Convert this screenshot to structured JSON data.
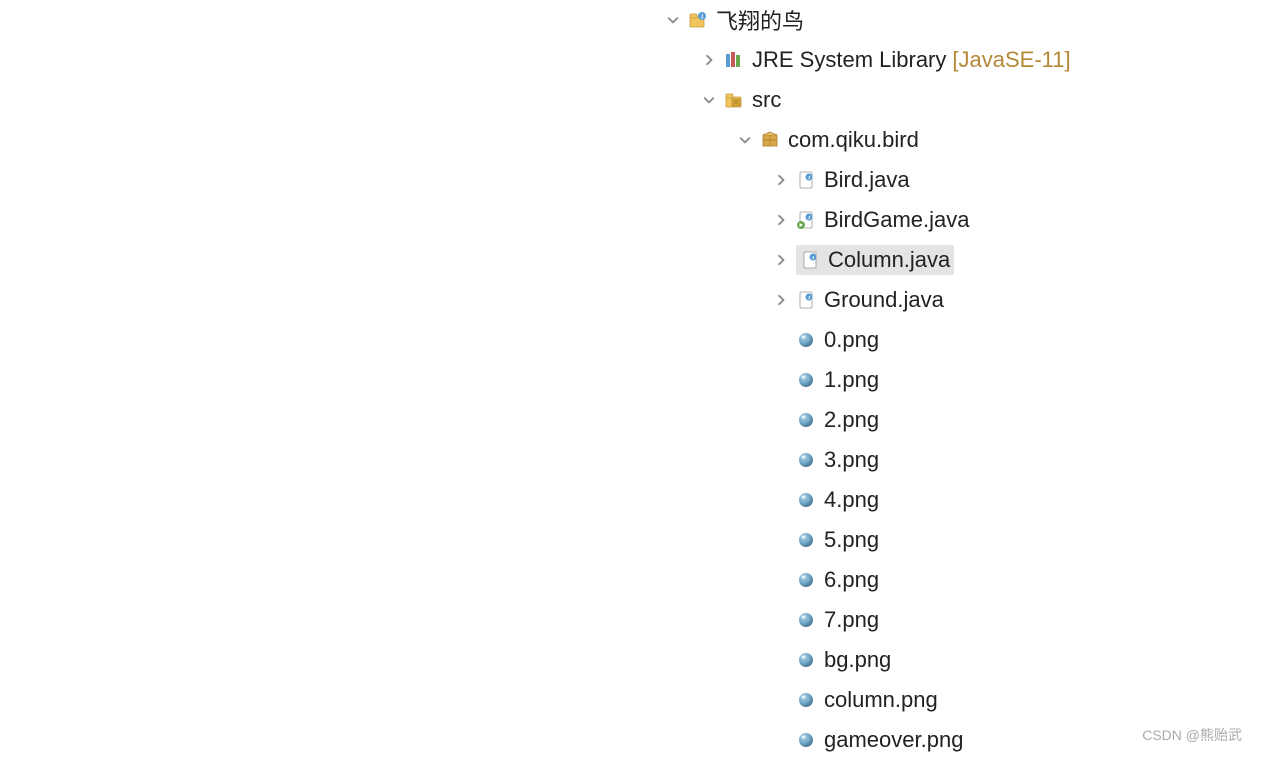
{
  "project": {
    "name": "飞翔的鸟"
  },
  "jre": {
    "label": "JRE System Library",
    "version": "[JavaSE-11]"
  },
  "src": {
    "label": "src"
  },
  "package": {
    "label": "com.qiku.bird"
  },
  "files": {
    "java": [
      "Bird.java",
      "BirdGame.java",
      "Column.java",
      "Ground.java"
    ],
    "png": [
      "0.png",
      "1.png",
      "2.png",
      "3.png",
      "4.png",
      "5.png",
      "6.png",
      "7.png",
      "bg.png",
      "column.png",
      "gameover.png"
    ]
  },
  "selected": "Column.java",
  "watermark": "CSDN @熊贻武"
}
